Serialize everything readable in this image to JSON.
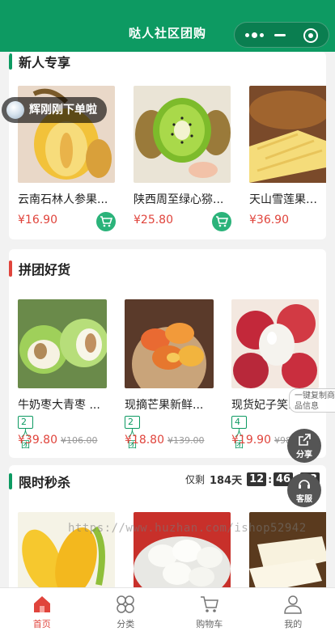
{
  "header": {
    "title": "哒人社区团购"
  },
  "toast": {
    "text": "辉刚刚下单啦"
  },
  "sections": {
    "new_user": {
      "title": "新人专享",
      "accent": "#0d9a62",
      "items": [
        {
          "name": "云南石林人参果...",
          "price": "¥16.90"
        },
        {
          "name": "陕西周至绿心猕...",
          "price": "¥25.80"
        },
        {
          "name": "天山雪莲果新鲜",
          "price": "¥36.90"
        }
      ]
    },
    "group": {
      "title": "拼团好货",
      "accent": "#e0443c",
      "items": [
        {
          "name": "牛奶枣大青枣 ...",
          "tag": "2人团",
          "price": "¥39.80",
          "orig": "¥106.00"
        },
        {
          "name": "现摘芒果新鲜...",
          "tag": "2人团",
          "price": "¥18.80",
          "orig": "¥139.00"
        },
        {
          "name": "现货妃子笑荔...",
          "tag": "4人团",
          "price": "¥19.90",
          "orig": "¥98.0"
        }
      ]
    },
    "flash": {
      "title": "限时秒杀",
      "accent": "#0d9a62",
      "countdown_prefix": "仅剩",
      "days": "184天",
      "hh": "12",
      "mm": "46",
      "ss": "03"
    }
  },
  "side": {
    "copy_tip": "一键复制商品信息",
    "share": "分享",
    "service": "客服"
  },
  "watermark": "https://www.huzhan.com/ishop52942",
  "tabbar": [
    {
      "label": "首页",
      "icon": "home-icon",
      "active": true
    },
    {
      "label": "分类",
      "icon": "category-icon",
      "active": false
    },
    {
      "label": "购物车",
      "icon": "cart-icon",
      "active": false
    },
    {
      "label": "我的",
      "icon": "user-icon",
      "active": false
    }
  ],
  "colors": {
    "primary": "#0d9a62",
    "price": "#e0443c"
  }
}
